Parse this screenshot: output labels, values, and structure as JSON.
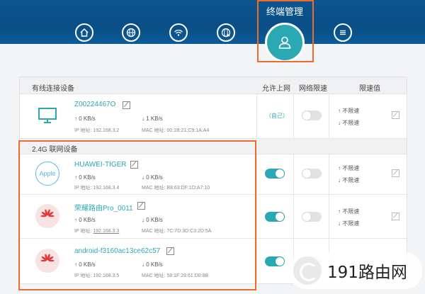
{
  "header": {
    "active_tab": "终端管理",
    "nav_icons": [
      "home-icon",
      "globe-icon",
      "wifi-icon",
      "globe-settings-icon",
      "terminal-user-icon",
      "menu-icon"
    ]
  },
  "table": {
    "wired_header": "有线连接设备",
    "col_internet": "允许上网",
    "col_limit": "网络限速",
    "col_limit_value": "限速值",
    "section_24g": "2.4G 联网设备",
    "ip_label": "IP 地址:",
    "mac_label": "MAC 地址:",
    "up_arrow": "↑",
    "down_arrow": "↓",
    "unlimited_up": "↑ 不限速",
    "unlimited_down": "↓ 不限速"
  },
  "devices": [
    {
      "name": "Z00224467O",
      "up": "0 KB/s",
      "down": "1 KB/s",
      "ip": "192.168.3.2",
      "mac": "00:1B:21:C9:1A:A4",
      "internet": "（自己）",
      "logo": "monitor-icon"
    },
    {
      "name": "HUAWEI-TIGER",
      "up": "0 KB/s",
      "down": "0 KB/s",
      "ip": "192.168.3.4",
      "mac": "B8:63:DF:1D:A7:10",
      "internet_on": true,
      "logo": "Apple"
    },
    {
      "name": "荣耀路由Pro_0011",
      "up": "0 KB/s",
      "down": "0 KB/s",
      "ip": "192.168.3.3",
      "mac": "7C:7D:3D:C3:2D:5A",
      "internet_on": true,
      "logo": "huawei-logo-icon"
    },
    {
      "name": "android-f3160ac13ce62c57",
      "up": "0 KB/s",
      "down": "0 KB/s",
      "ip": "192.168.3.5",
      "mac": "58:1F:28:61:D0:8B",
      "internet_on": true,
      "logo": "huawei-logo-icon"
    }
  ],
  "watermark": {
    "text": "191路由网"
  },
  "colors": {
    "header": "#0b5590",
    "accent": "#2aa8b3",
    "highlight": "#ef6b2a"
  }
}
